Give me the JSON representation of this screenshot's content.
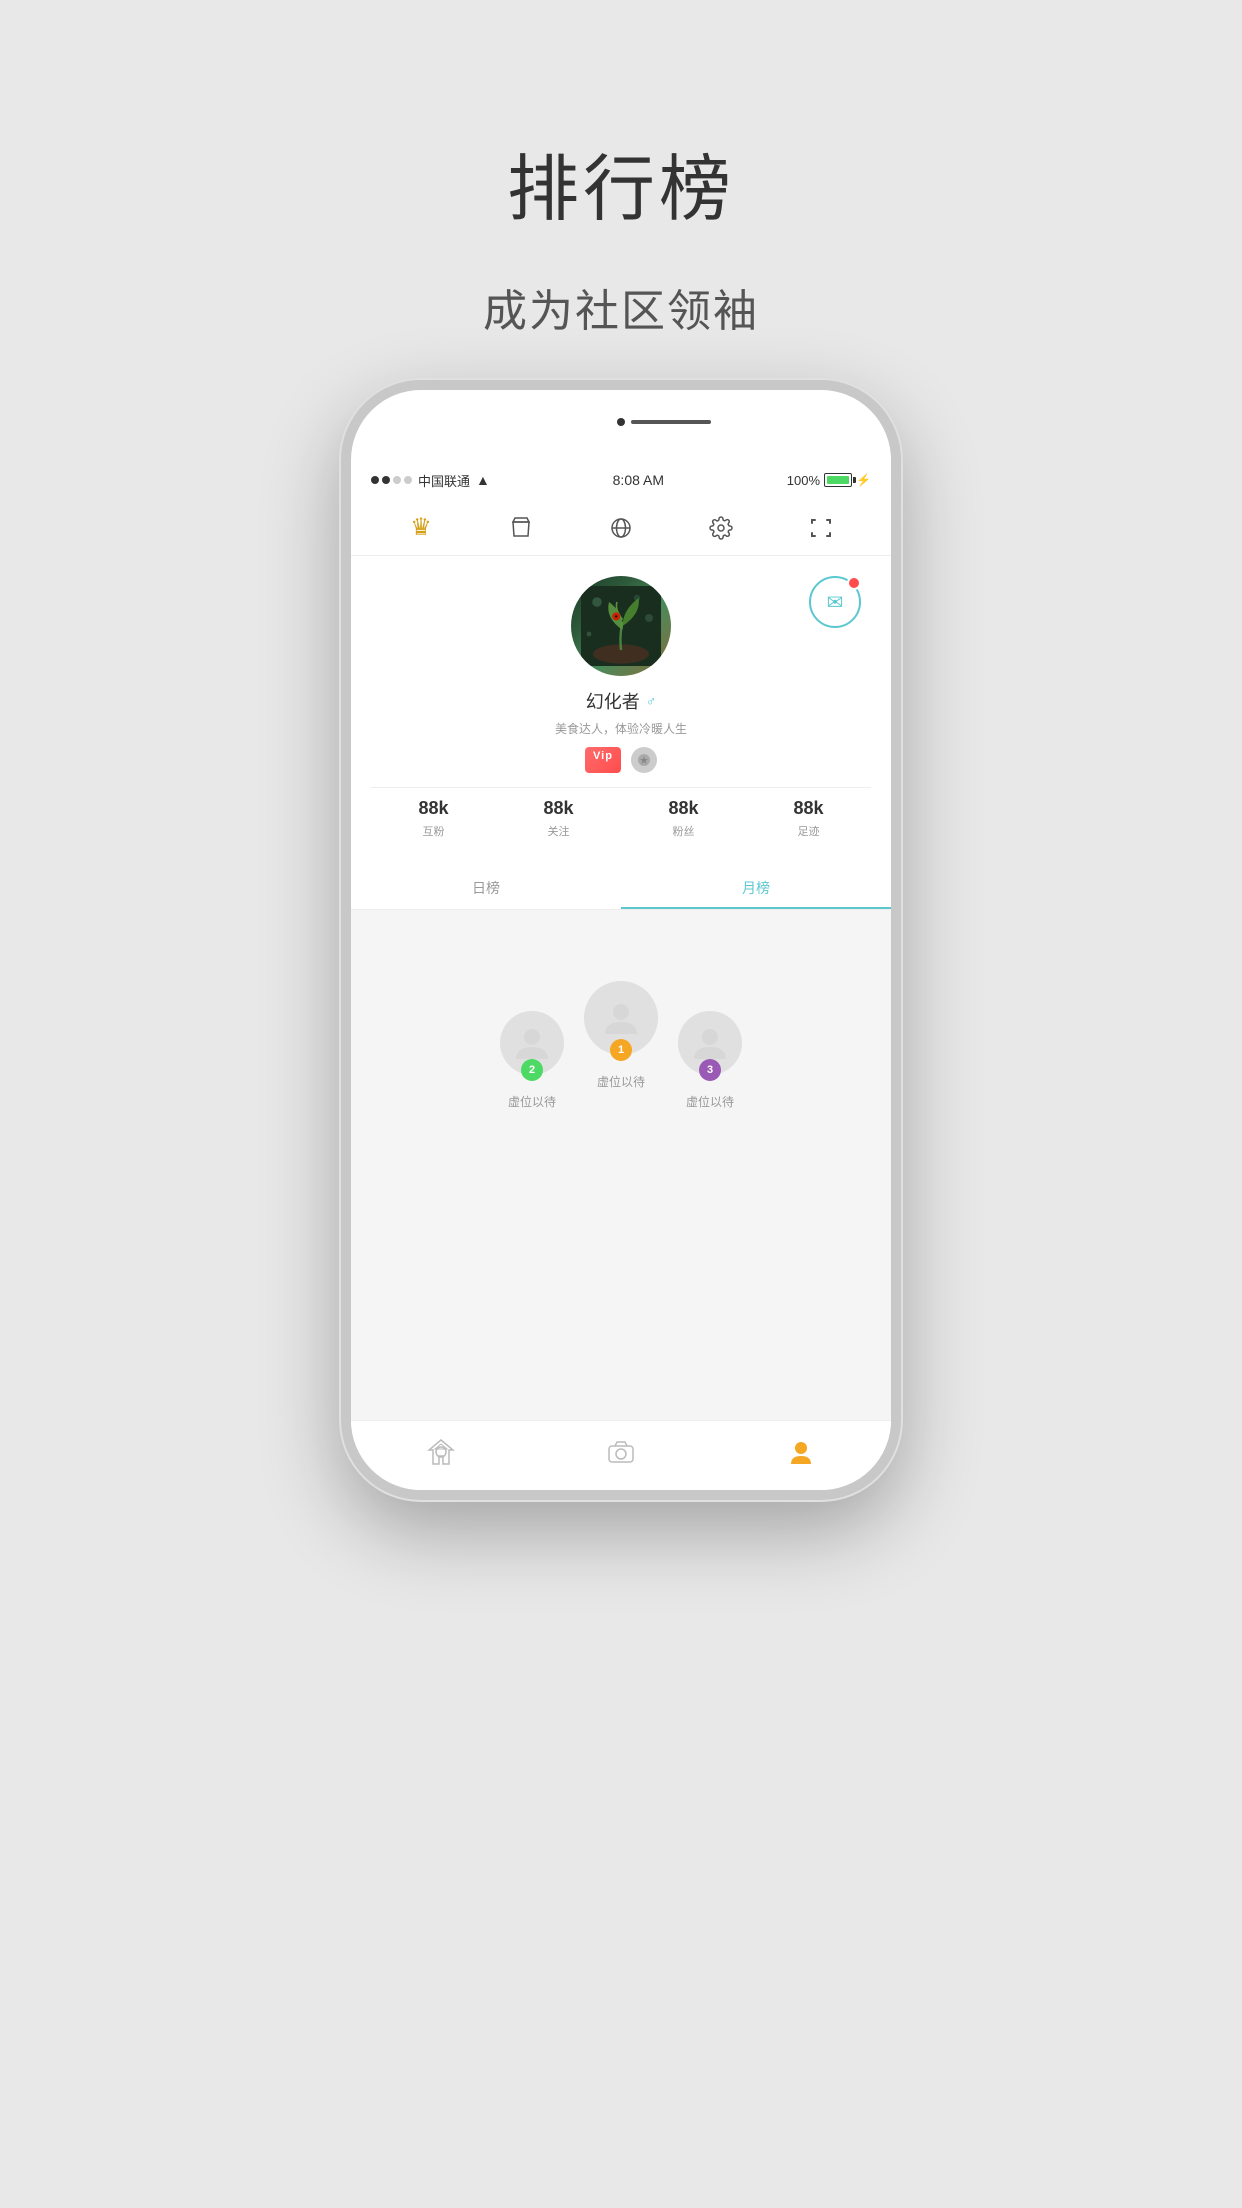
{
  "page": {
    "title": "排行榜",
    "subtitle": "成为社区领袖"
  },
  "status_bar": {
    "carrier": "中国联通",
    "wifi": "WiFi",
    "time": "8:08 AM",
    "battery": "100%"
  },
  "top_nav": {
    "icons": [
      {
        "name": "crown",
        "symbol": "♛"
      },
      {
        "name": "bag",
        "symbol": "👜"
      },
      {
        "name": "globe",
        "symbol": "🌐"
      },
      {
        "name": "settings",
        "symbol": "⚙"
      },
      {
        "name": "scan",
        "symbol": "▣"
      }
    ]
  },
  "profile": {
    "username": "幻化者",
    "bio": "美食达人，体验冷暖人生",
    "stats": [
      {
        "value": "88k",
        "label": "互粉"
      },
      {
        "value": "88k",
        "label": "关注"
      },
      {
        "value": "88k",
        "label": "粉丝"
      },
      {
        "value": "88k",
        "label": "足迹"
      }
    ],
    "badges": [
      "VIP",
      "Medal"
    ]
  },
  "tabs": [
    {
      "label": "日榜",
      "active": false
    },
    {
      "label": "月榜",
      "active": true
    }
  ],
  "ranking": {
    "podium": [
      {
        "rank": 2,
        "name": "虚位以待"
      },
      {
        "rank": 1,
        "name": "虚位以待"
      },
      {
        "rank": 3,
        "name": "虚位以待"
      }
    ]
  },
  "bottom_nav": {
    "items": [
      {
        "icon": "✦",
        "name": "home"
      },
      {
        "icon": "◎",
        "name": "camera"
      },
      {
        "icon": "☻",
        "name": "profile"
      }
    ]
  }
}
